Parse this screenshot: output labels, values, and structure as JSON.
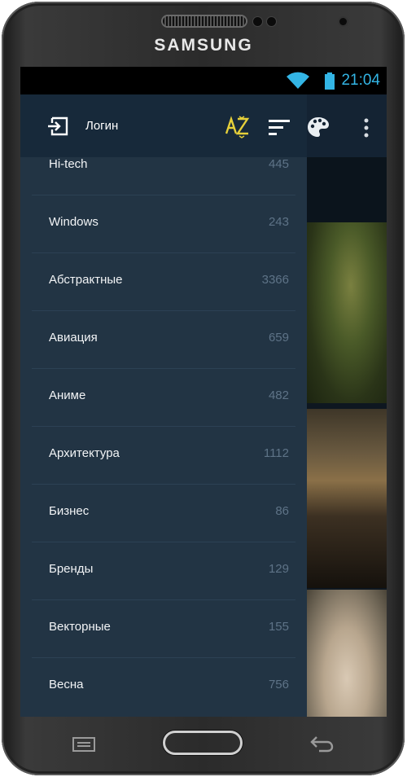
{
  "device": {
    "brand": "SAMSUNG"
  },
  "status_bar": {
    "time": "21:04",
    "icons": [
      "wifi-icon",
      "battery-icon"
    ],
    "accent_color": "#33b5e5"
  },
  "toolbar": {
    "actions": [
      "palette-icon",
      "more-vert-icon"
    ]
  },
  "drawer": {
    "header": {
      "login_label": "Логин",
      "login_icon": "login-icon",
      "az_icon": "sort-az-icon",
      "sort_icon": "sort-lines-icon"
    },
    "items": [
      {
        "label": "Hi-tech",
        "count": "445"
      },
      {
        "label": "Windows",
        "count": "243"
      },
      {
        "label": "Абстрактные",
        "count": "3366"
      },
      {
        "label": "Авиация",
        "count": "659"
      },
      {
        "label": "Аниме",
        "count": "482"
      },
      {
        "label": "Архитектура",
        "count": "1112"
      },
      {
        "label": "Бизнес",
        "count": "86"
      },
      {
        "label": "Бренды",
        "count": "129"
      },
      {
        "label": "Векторные",
        "count": "155"
      },
      {
        "label": "Весна",
        "count": "756"
      }
    ],
    "colors": {
      "background": "#223444",
      "header": "#17293a",
      "accent_az": "#e6d03a",
      "count_text": "#5e7387"
    }
  },
  "nav_bar": {
    "buttons": [
      "menu-icon",
      "home-button",
      "back-icon"
    ]
  }
}
